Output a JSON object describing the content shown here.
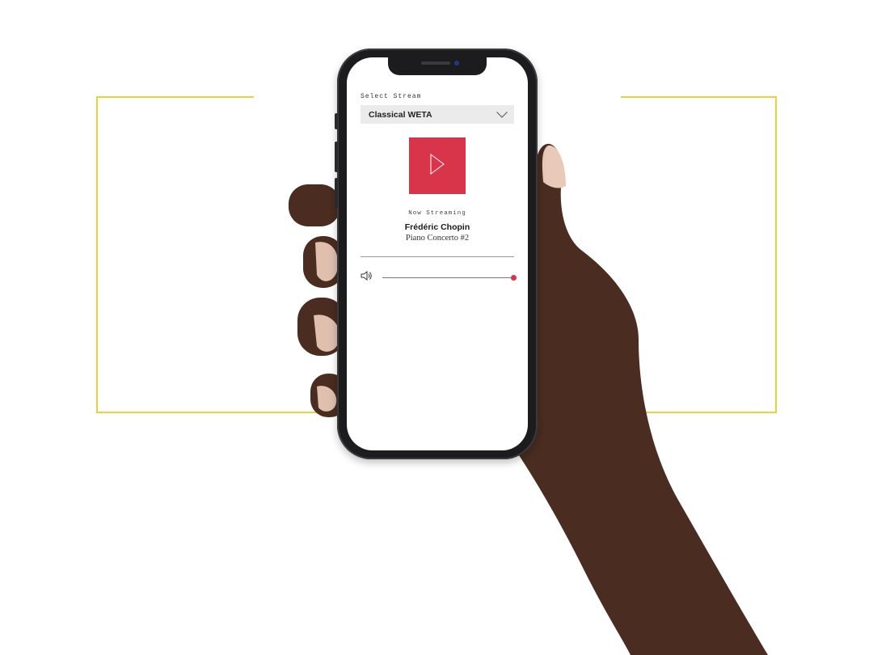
{
  "app": {
    "select_label": "Select Stream",
    "selected_stream": "Classical WETA",
    "now_label": "Now Streaming",
    "artist": "Frédéric Chopin",
    "work": "Piano Concerto #2",
    "volume_level": 1.0
  },
  "icons": {
    "dropdown": "chevron-down-icon",
    "play": "play-icon",
    "volume": "speaker-icon"
  },
  "colors": {
    "accent": "#d9354a",
    "frame": "#f2cf3a",
    "select_bg": "#ebebeb"
  }
}
